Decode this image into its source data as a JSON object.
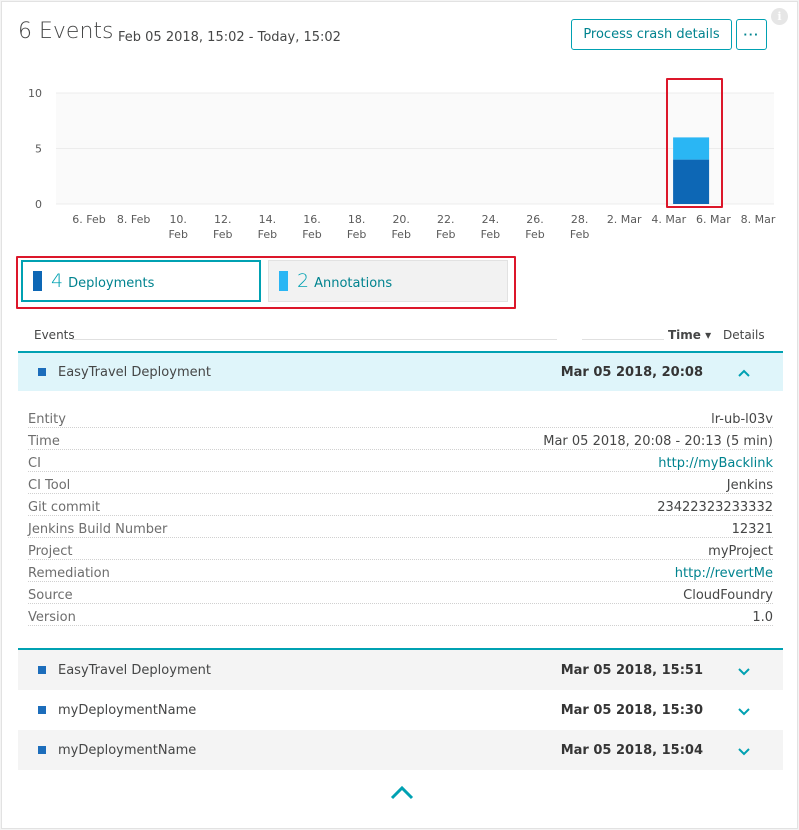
{
  "header": {
    "title": "6 Events",
    "range": "Feb 05 2018, 15:02 - Today, 15:02",
    "crash_button": "Process crash details",
    "more_button": "···",
    "info": "i"
  },
  "colors": {
    "accent": "#00a1b2",
    "deployment": "#0d67b5",
    "annotation": "#2ab6f4",
    "highlight": "#dc172a"
  },
  "chart_data": {
    "type": "bar",
    "stacked": true,
    "yticks": [
      0,
      5,
      10
    ],
    "ylim": [
      0,
      10
    ],
    "x_tick_labels": [
      [
        "6. Feb",
        ""
      ],
      [
        "8. Feb",
        ""
      ],
      [
        "10.",
        "Feb"
      ],
      [
        "12.",
        "Feb"
      ],
      [
        "14.",
        "Feb"
      ],
      [
        "16.",
        "Feb"
      ],
      [
        "18.",
        "Feb"
      ],
      [
        "20.",
        "Feb"
      ],
      [
        "22.",
        "Feb"
      ],
      [
        "24.",
        "Feb"
      ],
      [
        "26.",
        "Feb"
      ],
      [
        "28.",
        "Feb"
      ],
      [
        "2. Mar",
        ""
      ],
      [
        "4. Mar",
        ""
      ],
      [
        "6. Mar",
        ""
      ],
      [
        "8. Mar",
        ""
      ]
    ],
    "categories": [
      "5. Mar"
    ],
    "series": [
      {
        "name": "Deployments",
        "values": [
          4
        ]
      },
      {
        "name": "Annotations",
        "values": [
          2
        ]
      }
    ],
    "grid": true
  },
  "summary": {
    "deployments": {
      "count": "4",
      "label": "Deployments"
    },
    "annotations": {
      "count": "2",
      "label": "Annotations"
    }
  },
  "table": {
    "col_events": "Events",
    "col_time": "Time ▾",
    "col_details": "Details",
    "rows": [
      {
        "name": "EasyTravel Deployment",
        "time": "Mar 05 2018, 20:08",
        "chevron": "⌃"
      },
      {
        "name": "EasyTravel Deployment",
        "time": "Mar 05 2018, 15:51",
        "chevron": "⌄"
      },
      {
        "name": "myDeploymentName",
        "time": "Mar 05 2018, 15:30",
        "chevron": "⌄"
      },
      {
        "name": "myDeploymentName",
        "time": "Mar 05 2018, 15:04",
        "chevron": "⌄"
      }
    ]
  },
  "details": [
    {
      "key": "Entity",
      "value": "lr-ub-l03v"
    },
    {
      "key": "Time",
      "value": "Mar 05 2018, 20:08 - 20:13 (5 min)"
    },
    {
      "key": "CI",
      "value": "http://myBacklink"
    },
    {
      "key": "CI Tool",
      "value": "Jenkins"
    },
    {
      "key": "Git commit",
      "value": "23422323233332"
    },
    {
      "key": "Jenkins Build Number",
      "value": "12321"
    },
    {
      "key": "Project",
      "value": "myProject"
    },
    {
      "key": "Remediation",
      "value": "http://revertMe"
    },
    {
      "key": "Source",
      "value": "CloudFoundry"
    },
    {
      "key": "Version",
      "value": "1.0"
    }
  ]
}
